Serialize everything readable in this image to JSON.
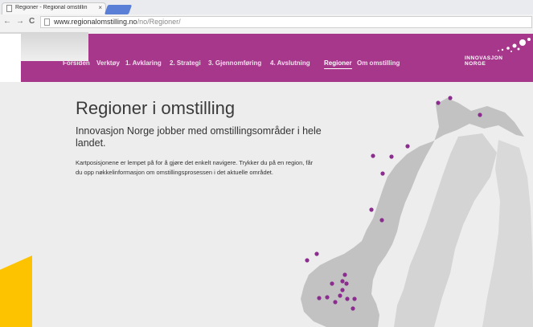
{
  "browser": {
    "tab_title": "Regioner - Regional omstillin",
    "tab_close": "×",
    "back": "←",
    "forward": "→",
    "reload": "C",
    "url_host": "www.regionalomstilling.no",
    "url_path": "/no/Regioner/"
  },
  "site_nav": {
    "items": [
      "Forsiden",
      "Verktøy",
      "1. Avklaring",
      "2. Strategi",
      "3. Gjennomføring",
      "4. Avslutning",
      "Regioner",
      "Om omstilling"
    ],
    "active_index": 6
  },
  "logo": {
    "line1": "INNOVASJON",
    "line2": "NORGE"
  },
  "main": {
    "title": "Regioner i omstilling",
    "subtitle": "Innovasjon Norge jobber med omstillingsområder i hele landet.",
    "description": "Kartposisjonene er lempet på for å gjøre det enkelt navigere. Trykker du på en region, får du opp nøkkelinformasjon om omstillingsprosessen i det aktuelle området."
  },
  "colors": {
    "brand": "#a6378b",
    "marker": "#8b2d8e",
    "accent": "#fdc300"
  }
}
